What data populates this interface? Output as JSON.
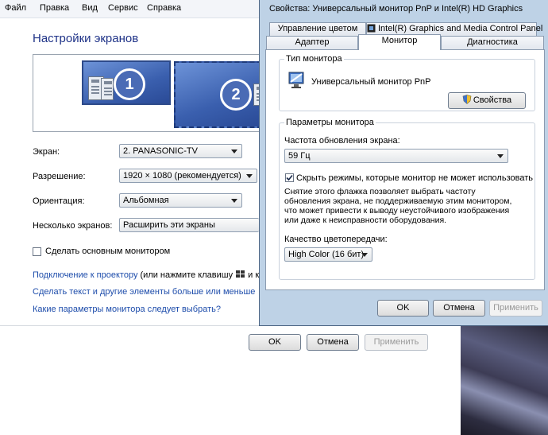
{
  "menu": [
    "Файл",
    "Правка",
    "Вид",
    "Сервис",
    "Справка"
  ],
  "screen_settings": {
    "heading": "Настройки экранов",
    "monitor1_number": "1",
    "monitor2_number": "2",
    "screen_label": "Экран:",
    "screen_value": "2. PANASONIC-TV",
    "resolution_label": "Разрешение:",
    "resolution_value": "1920 × 1080 (рекомендуется)",
    "orientation_label": "Ориентация:",
    "orientation_value": "Альбомная",
    "multiple_label": "Несколько экранов:",
    "multiple_value": "Расширить эти экраны",
    "main_monitor_label": "Сделать основным монитором",
    "projector_link": "Подключение к проектору",
    "projector_suffix": " (или нажмите клавишу ",
    "projector_key_tail": " и к",
    "text_size_link": "Сделать текст и другие элементы больше или меньше",
    "which_params_link": "Какие параметры монитора следует выбрать?",
    "ok": "OK",
    "cancel": "Отмена",
    "apply": "Применить"
  },
  "dialog": {
    "title": "Свойства: Универсальный монитор PnP и Intel(R) HD Graphics",
    "tabs_row1": [
      "Управление цветом",
      "Intel(R) Graphics and Media Control Panel"
    ],
    "tabs_row2": [
      "Адаптер",
      "Монитор",
      "Диагностика"
    ],
    "active_tab": "Монитор",
    "monitor_type_group": "Тип монитора",
    "monitor_name": "Универсальный монитор PnP",
    "properties_button": "Свойства",
    "monitor_params_group": "Параметры монитора",
    "refresh_label": "Частота обновления экрана:",
    "refresh_value": "59 Гц",
    "hide_modes_label": "Скрыть режимы, которые монитор не может использовать",
    "hide_modes_checked": true,
    "hint_text": "Снятие этого флажка позволяет выбрать частоту обновления экрана, не поддерживаемую этим монитором, что может привести к выводу неустойчивого изображения или даже к неисправности оборудования.",
    "color_quality_label": "Качество цветопередачи:",
    "color_quality_value": "High Color (16 бит)",
    "ok": "OK",
    "cancel": "Отмена",
    "apply": "Применить"
  },
  "colors": {
    "heading_blue": "#1e3287",
    "link_blue": "#1e4dab",
    "dialog_frame": "#bed2e6",
    "monitor_blue": "#4a6fbd"
  },
  "icons": [
    "monitor-icon",
    "shield-icon",
    "windows-key-icon",
    "dropdown-arrow-icon",
    "checkmark-icon"
  ]
}
